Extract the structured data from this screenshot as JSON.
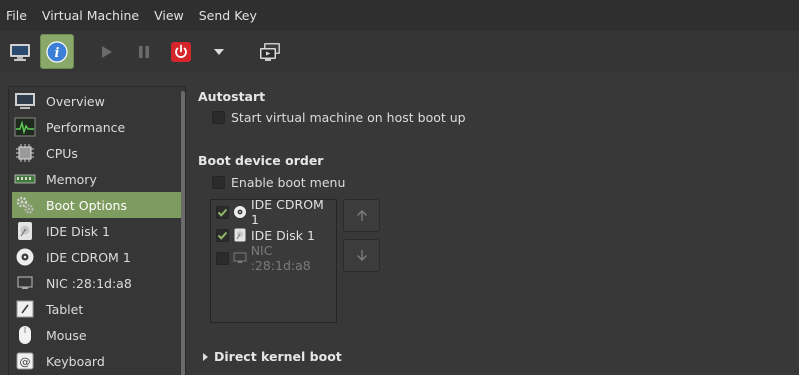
{
  "menubar": {
    "items": [
      "File",
      "Virtual Machine",
      "View",
      "Send Key"
    ]
  },
  "toolbar": {
    "buttons": [
      {
        "icon": "monitor-icon",
        "name": "console"
      },
      {
        "icon": "info-icon",
        "name": "details",
        "active": true
      },
      {
        "icon": "play-icon",
        "name": "run"
      },
      {
        "icon": "pause-icon",
        "name": "pause"
      },
      {
        "icon": "power-icon",
        "name": "shutdown"
      },
      {
        "icon": "chevron-down-icon",
        "name": "shutdown-menu"
      },
      {
        "icon": "screens-icon",
        "name": "snapshots"
      }
    ]
  },
  "sidebar": {
    "items": [
      {
        "label": "Overview",
        "icon": "monitor-icon"
      },
      {
        "label": "Performance",
        "icon": "performance-graph-icon"
      },
      {
        "label": "CPUs",
        "icon": "cpu-chip-icon"
      },
      {
        "label": "Memory",
        "icon": "memory-stick-icon"
      },
      {
        "label": "Boot Options",
        "icon": "gears-icon",
        "selected": true
      },
      {
        "label": "IDE Disk 1",
        "icon": "disk-icon"
      },
      {
        "label": "IDE CDROM 1",
        "icon": "cdrom-icon"
      },
      {
        "label": "NIC :28:1d:a8",
        "icon": "nic-icon"
      },
      {
        "label": "Tablet",
        "icon": "tablet-icon"
      },
      {
        "label": "Mouse",
        "icon": "mouse-icon"
      },
      {
        "label": "Keyboard",
        "icon": "keyboard-icon"
      }
    ]
  },
  "autostart": {
    "title": "Autostart",
    "option_label": "Start virtual machine on host boot up",
    "checked": false
  },
  "boot_order": {
    "title": "Boot device order",
    "enable_menu_label": "Enable boot menu",
    "enable_menu_checked": false,
    "devices": [
      {
        "label": "IDE CDROM 1",
        "icon": "cdrom-icon",
        "checked": true,
        "enabled": true
      },
      {
        "label": "IDE Disk 1",
        "icon": "disk-icon",
        "checked": true,
        "enabled": true
      },
      {
        "label": "NIC :28:1d:a8",
        "icon": "nic-icon",
        "checked": false,
        "enabled": false
      }
    ],
    "move_up_icon": "arrow-up-icon",
    "move_down_icon": "arrow-down-icon"
  },
  "direct_kernel": {
    "label": "Direct kernel boot",
    "expanded": false
  },
  "colors": {
    "accent": "#7e9b60",
    "check": "#8fb86a",
    "power_red": "#d4262b"
  }
}
